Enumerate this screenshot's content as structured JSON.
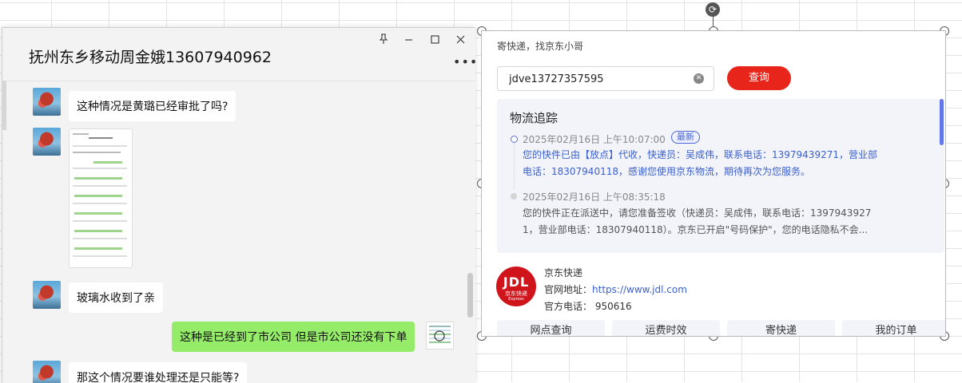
{
  "chat": {
    "title": "抚州东乡移动周金娥13607940962",
    "pin_icon": "pin-icon",
    "minimize_icon": "minimize-icon",
    "maximize_icon": "maximize-icon",
    "close_icon": "close-icon",
    "more": "•••",
    "messages": [
      {
        "from": "other",
        "text": "这种情况是黄璐已经审批了吗?"
      },
      {
        "from": "other",
        "image": "screenshot-image"
      },
      {
        "from": "other",
        "text": "玻璃水收到了亲"
      },
      {
        "from": "me",
        "text": "这种是已经到了市公司 但是市公司还没有下单"
      },
      {
        "from": "other",
        "text": "那这个情况要谁处理还是只能等?"
      }
    ]
  },
  "panel": {
    "header": "寄快递，找京东小哥",
    "search": {
      "value": "jdve13727357595",
      "clear_icon": "clear-icon"
    },
    "query_label": "查询",
    "tracking": {
      "title": "物流追踪",
      "events": [
        {
          "time": "2025年02月16日 上午10:07:00",
          "badge": "最新",
          "line1": "您的快件已由【放点】代收，快递员：吴成伟，联系电话：13979439271，营业部",
          "line2": "电话：18307940118，感谢您使用京东物流，期待再次为您服务。"
        },
        {
          "time": "2025年02月16日 上午08:35:18",
          "line1": "您的快件正在派送中，请您准备签收（快递员：吴成伟，联系电话：1397943927",
          "line2": "1，营业部电话：18307940118）。京东已开启\"号码保护\"，您的电话隐私不会..."
        }
      ]
    },
    "company": {
      "logo_text": "JDL",
      "logo_cn": "京东快递",
      "logo_en": "Express",
      "name": "京东快递",
      "site_label": "官网地址：",
      "site_url": "https://www.jdl.com",
      "phone_label": "官方电话：",
      "phone": "950616"
    },
    "tabs": [
      "网点查询",
      "运费时效",
      "寄快递",
      "我的订单"
    ]
  },
  "colors": {
    "accent_red": "#e8251a",
    "link_blue": "#3a5fcf",
    "bubble_green": "#95ec69"
  }
}
